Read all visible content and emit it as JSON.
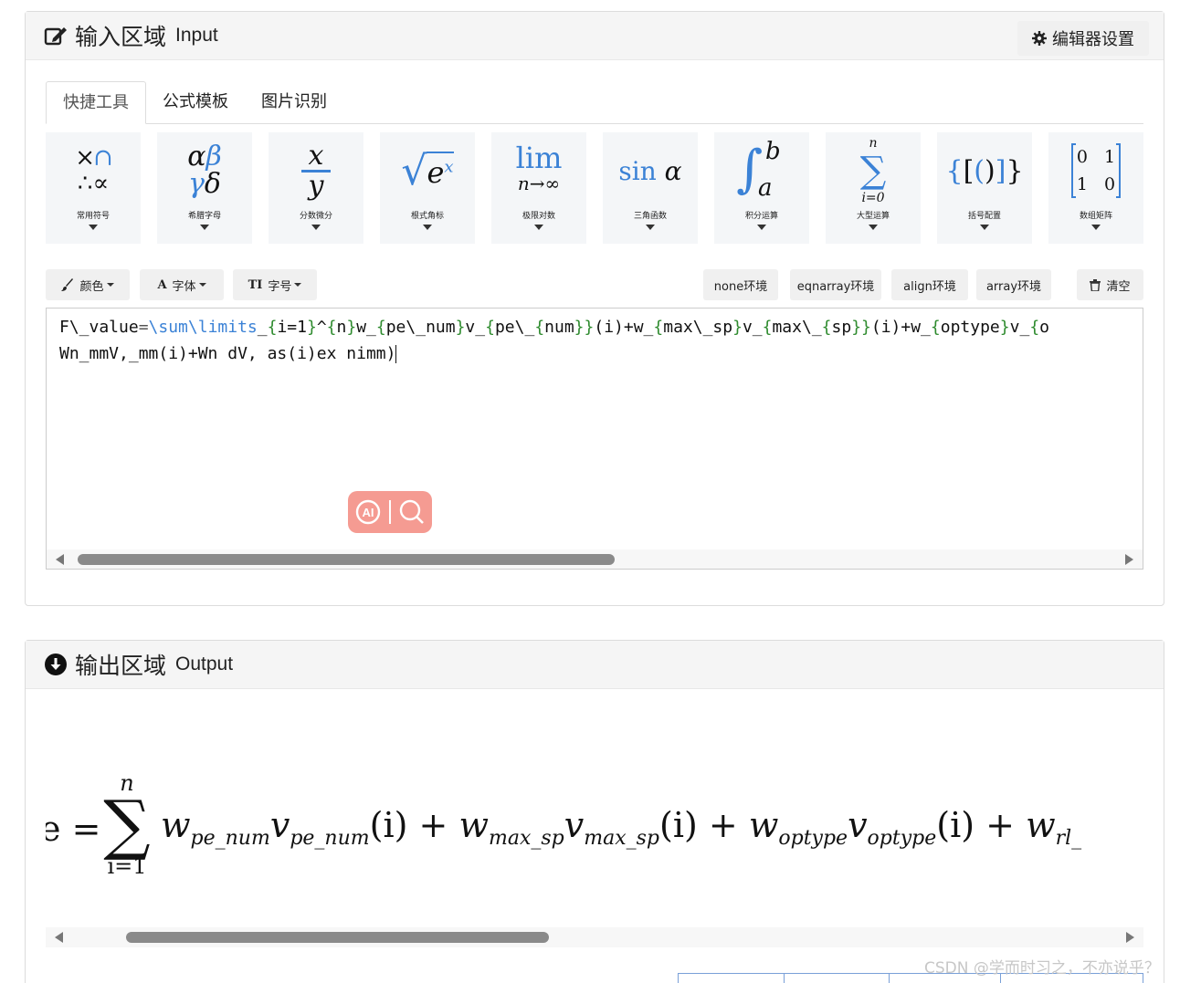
{
  "input_panel": {
    "title_cn": "输入区域",
    "title_en": "Input",
    "settings_label": "编辑器设置"
  },
  "tabs": [
    "快捷工具",
    "公式模板",
    "图片识别"
  ],
  "symbol_groups": [
    {
      "label": "常用符号"
    },
    {
      "label": "希腊字母"
    },
    {
      "label": "分数微分"
    },
    {
      "label": "根式角标"
    },
    {
      "label": "极限对数"
    },
    {
      "label": "三角函数"
    },
    {
      "label": "积分运算"
    },
    {
      "label": "大型运算"
    },
    {
      "label": "括号配置"
    },
    {
      "label": "数组矩阵"
    }
  ],
  "toolbar": {
    "color": "颜色",
    "font": "字体",
    "size": "字号",
    "env_none": "none环境",
    "env_eqnarray": "eqnarray环境",
    "env_align": "align环境",
    "env_array": "array环境",
    "clear": "清空"
  },
  "editor": {
    "line1": "F\\_value=\\sum\\limits_{i=1}^{n}w_{pe\\_num}v_{pe\\_{num}}(i)+w_{max\\_sp}v_{max\\_{sp}}(i)+w_{optype}v_{o",
    "line2": "Wn_mmV,_mm(i)+Wn dV, as(i)ex nimm)"
  },
  "output_panel": {
    "title_cn": "输出区域",
    "title_en": "Output"
  },
  "formula": {
    "lead": "e =",
    "sum_upper": "n",
    "sum_lower": "i=1",
    "t1": "w",
    "t1_sub": "pe_num",
    "t2": "v",
    "t2_sub": "pe_num",
    "arg": "(i)",
    "plus": "+",
    "t3": "w",
    "t3_sub": "max_sp",
    "t4": "v",
    "t4_sub": "max_sp",
    "t5": "w",
    "t5_sub": "optype",
    "t6": "v",
    "t6_sub": "optype",
    "t7": "w",
    "t7_sub": "rl_"
  },
  "watermark": "CSDN @学而时习之，不亦说乎？"
}
